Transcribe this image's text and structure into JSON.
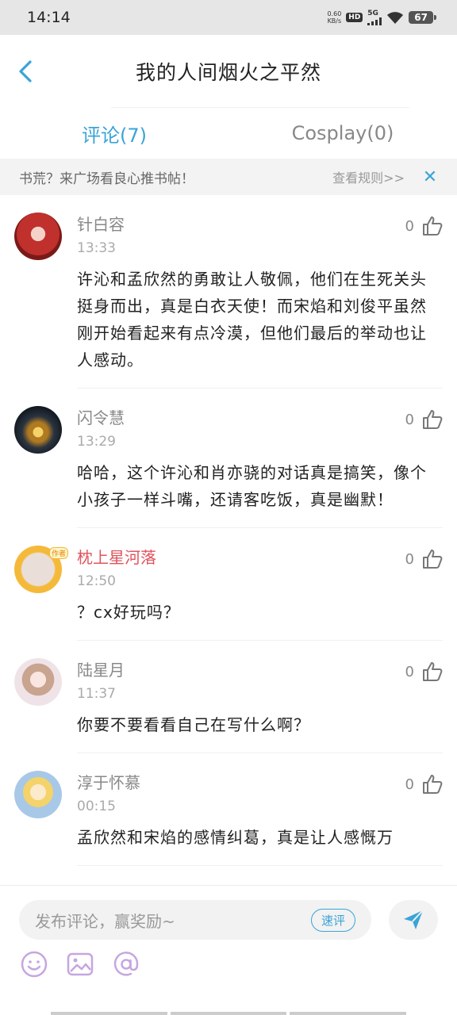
{
  "status_bar": {
    "time": "14:14",
    "speed_value": "0.60",
    "speed_unit": "KB/s",
    "hd": "HD",
    "network": "5G",
    "battery": "67"
  },
  "header": {
    "title": "我的人间烟火之平然"
  },
  "tabs": [
    {
      "label": "评论(7)",
      "active": true
    },
    {
      "label": "Cosplay(0)",
      "active": false
    }
  ],
  "banner": {
    "text": "书荒？来广场看良心推书帖！",
    "rules_link": "查看规则>>",
    "close": "✕"
  },
  "comments": [
    {
      "name": "针白容",
      "time": "13:33",
      "text": "许沁和孟欣然的勇敢让人敬佩，他们在生死关头挺身而出，真是白衣天使！而宋焰和刘俊平虽然刚开始看起来有点冷漠，但他们最后的举动也让人感动。",
      "likes": "0"
    },
    {
      "name": "闪令慧",
      "time": "13:29",
      "text": "哈哈，这个许沁和肖亦骁的对话真是搞笑，像个小孩子一样斗嘴，还请客吃饭，真是幽默！",
      "likes": "0"
    },
    {
      "name": "枕上星河落",
      "time": "12:50",
      "text": "？cx好玩吗？",
      "likes": "0",
      "author": true,
      "badge": "作者"
    },
    {
      "name": "陆星月",
      "time": "11:37",
      "text": "你要不要看看自己在写什么啊？",
      "likes": "0"
    },
    {
      "name": "淳于怀慕",
      "time": "00:15",
      "text": "孟欣然和宋焰的感情纠葛，真是让人感慨万",
      "likes": "0"
    }
  ],
  "bottom": {
    "placeholder": "发布评论，赢奖励~",
    "quick_review": "速评"
  }
}
